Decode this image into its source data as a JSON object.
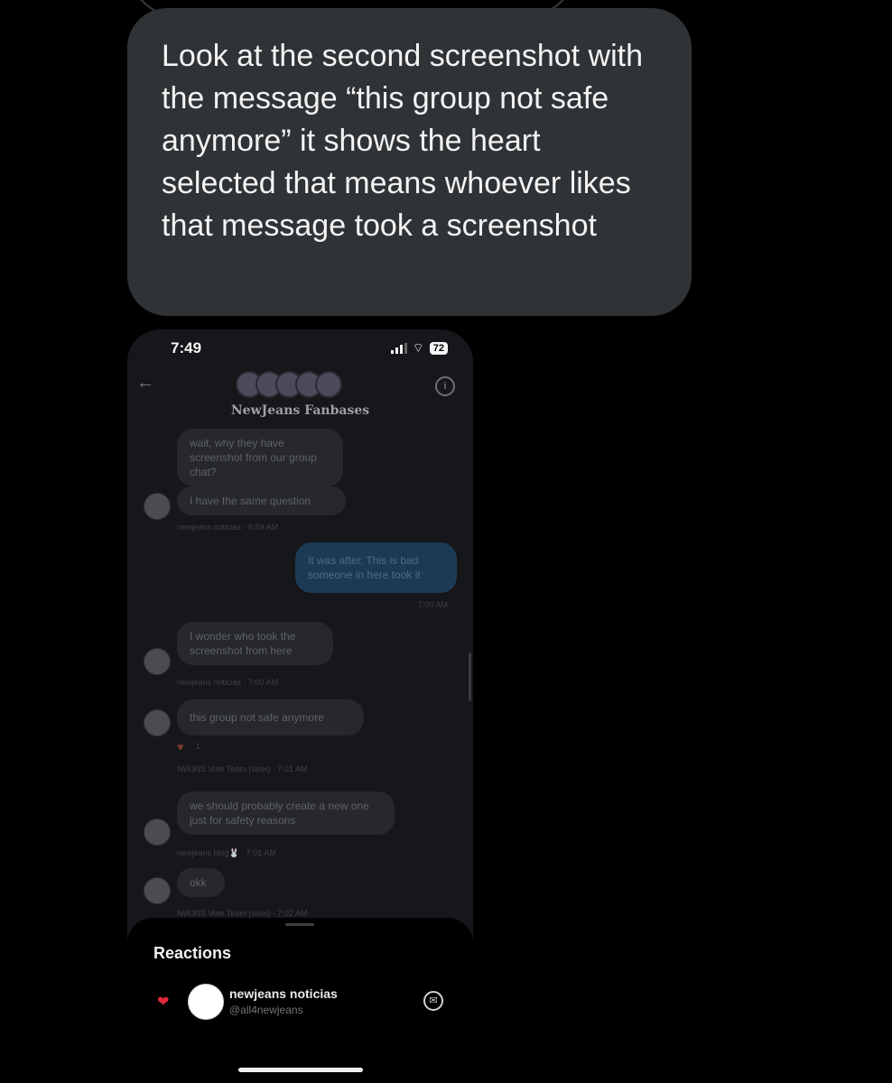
{
  "post": {
    "text": "Look at the second screenshot with the message “this group not safe anymore” it shows the heart selected that means whoever likes that message took a screenshot"
  },
  "phone": {
    "status": {
      "time": "7:49",
      "battery": "72"
    },
    "chat_title": "NewJeans Fanbases",
    "messages": [
      {
        "text": "wait, why they have screenshot from our group chat?"
      },
      {
        "text": "I have the same question",
        "meta": "newjeans noticias · 6:59 AM"
      },
      {
        "text": "It was after. This is bad someone in here took it",
        "meta": "7:00 AM"
      },
      {
        "text": "I wonder who took the screenshot from here",
        "meta": "newjeans noticias · 7:00 AM"
      },
      {
        "text": "this group not safe anymore",
        "reaction_count": "1",
        "meta": "NWJNS Vote Team (slow) · 7:01 AM"
      },
      {
        "text": "we should probably create a new one just for safety reasons",
        "meta": "newjeans blog🐰 · 7:01 AM"
      },
      {
        "text": "okk",
        "meta": "NWJNS Vote Team (slow) · 7:02 AM"
      }
    ]
  },
  "reactions_sheet": {
    "title": "Reactions",
    "items": [
      {
        "emoji": "❤",
        "name": "newjeans noticias",
        "handle": "@all4newjeans"
      }
    ]
  },
  "icons": {
    "back": "back-arrow-icon",
    "info": "info-icon",
    "heart": "heart-icon",
    "message": "message-icon"
  },
  "colors": {
    "bubble_bg": "#2f3336",
    "heart": "#e0293a",
    "outgoing": "#1d3a55"
  }
}
